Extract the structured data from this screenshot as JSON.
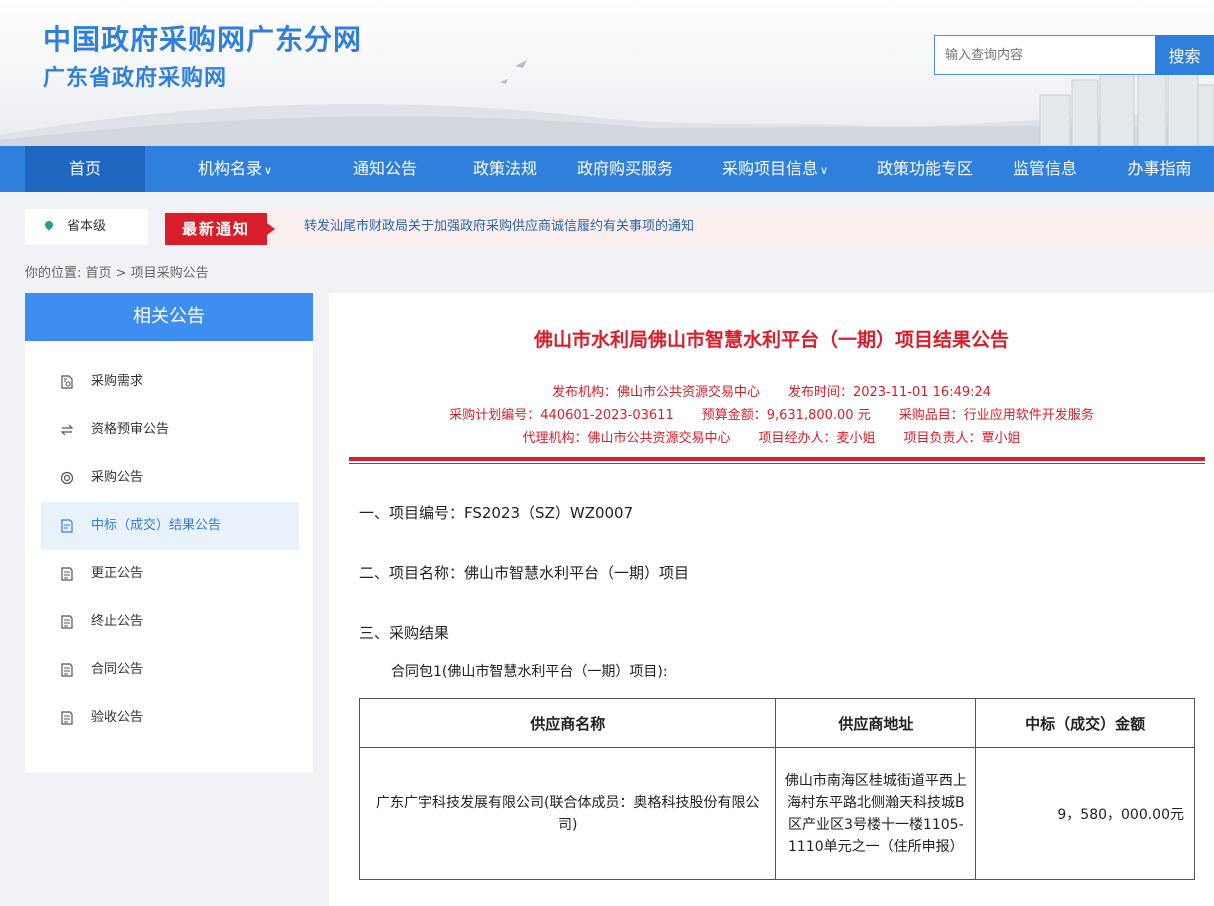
{
  "header": {
    "title_line1": "中国政府采购网广东分网",
    "title_line2": "广东省政府采购网",
    "search_placeholder": "输入查询内容",
    "search_button": "搜索"
  },
  "nav": {
    "items": [
      {
        "label": "首页"
      },
      {
        "label": "机构名录"
      },
      {
        "label": "通知公告"
      },
      {
        "label": "政策法规"
      },
      {
        "label": "政府购买服务"
      },
      {
        "label": "采购项目信息"
      },
      {
        "label": "政策功能专区"
      },
      {
        "label": "监管信息"
      },
      {
        "label": "办事指南"
      }
    ],
    "chevron": "∨"
  },
  "location": {
    "label": "省本级"
  },
  "notice": {
    "tag": "最新通知",
    "text": "转发汕尾市财政局关于加强政府采购供应商诚信履约有关事项的通知"
  },
  "breadcrumb": "你的位置:  首页 > 项目采购公告",
  "sidebar": {
    "title": "相关公告",
    "items": [
      {
        "label": "采购需求",
        "icon": "document-search-icon"
      },
      {
        "label": "资格预审公告",
        "icon": "swap-icon"
      },
      {
        "label": "采购公告",
        "icon": "target-icon"
      },
      {
        "label": "中标（成交）结果公告",
        "icon": "document-icon"
      },
      {
        "label": "更正公告",
        "icon": "document-icon"
      },
      {
        "label": "终止公告",
        "icon": "document-icon"
      },
      {
        "label": "合同公告",
        "icon": "document-icon"
      },
      {
        "label": "验收公告",
        "icon": "document-icon"
      }
    ]
  },
  "article": {
    "title": "佛山市水利局佛山市智慧水利平台（一期）项目结果公告",
    "meta": {
      "publisher": "发布机构：佛山市公共资源交易中心",
      "publish_time": "发布时间：2023-11-01 16:49:24",
      "plan_no": "采购计划编号：440601-2023-03611",
      "budget": "预算金额：9,631,800.00 元",
      "category": "采购品目：行业应用软件开发服务",
      "agency": "代理机构：佛山市公共资源交易中心",
      "handler": "项目经办人：麦小姐",
      "manager": "项目负责人：覃小姐"
    },
    "sec1": "一、项目编号：FS2023（SZ）WZ0007",
    "sec2": "二、项目名称：佛山市智慧水利平台（一期）项目",
    "sec3": "三、采购结果",
    "package": "合同包1(佛山市智慧水利平台（一期）项目):",
    "table": {
      "headers": [
        "供应商名称",
        "供应商地址",
        "中标（成交）金额"
      ],
      "rows": [
        {
          "name": "广东广宇科技发展有限公司(联合体成员：奥格科技股份有限公司)",
          "address": "佛山市南海区桂城街道平西上海村东平路北侧瀚天科技城B区产业区3号楼十一楼1105-1110单元之一（住所申报）",
          "amount": "9，580，000.00元"
        }
      ]
    }
  }
}
